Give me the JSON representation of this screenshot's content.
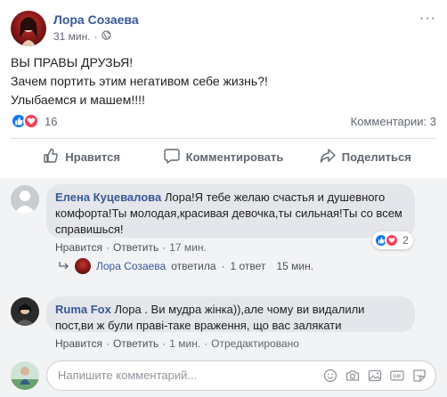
{
  "post": {
    "author": "Лора Созаева",
    "time": "31 мин.",
    "privacy_icon": "globe-icon",
    "more_label": "···",
    "text_lines": [
      "ВЫ ПРАВЫ ДРУЗЬЯ!",
      "Зачем портить этим негативом себе жизнь?!",
      "Улыбаемся и машем!!!!"
    ],
    "reactions_count": "16",
    "comments_count": "Комментарии: 3"
  },
  "actions": {
    "like": "Нравится",
    "comment": "Комментировать",
    "share": "Поделиться"
  },
  "comments": [
    {
      "name": "Елена Куцевалова",
      "text": "Лора!Я тебе желаю счастья и душевного комфорта!Ты молодая,красивая девочка,ты сильная!Ты со всем справишься!",
      "like": "Нравится",
      "reply": "Ответить",
      "time": "17 мин.",
      "reactions": "2"
    },
    {
      "name": "Ruma Fox",
      "text": "Лора . Ви мудра жінка)),але чому ви видалили пост,ви ж були праві-таке враження, що вас залякати",
      "like": "Нравится",
      "reply": "Ответить",
      "time": "1 мин.",
      "edited": "Отредактировано"
    }
  ],
  "reply_summary": {
    "name": "Лора Созаева",
    "action": "ответила",
    "count": "1 ответ",
    "time": "15 мин."
  },
  "composer": {
    "placeholder": "Напишите комментарий...",
    "icons": [
      "smile-icon",
      "camera-icon",
      "photo-icon",
      "gif-icon",
      "sticker-icon"
    ]
  },
  "colors": {
    "link": "#385898",
    "like_blue": "#1877f2",
    "love_red": "#f33e58",
    "bubble": "#e4e6eb",
    "comments_bg": "#f2f3f5"
  }
}
